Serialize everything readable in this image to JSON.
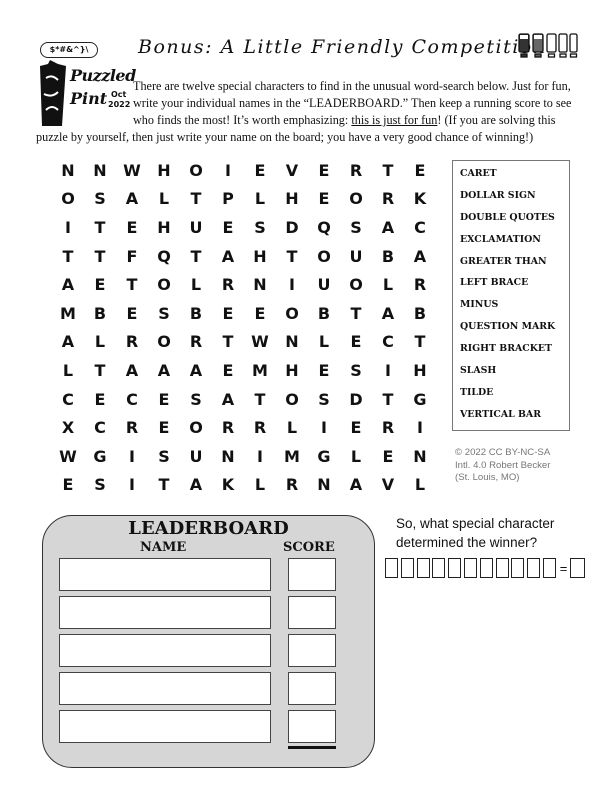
{
  "header": {
    "title": "Bonus: A Little Friendly Competition"
  },
  "logo": {
    "symbols": "$*#&^}\\",
    "line1": "Puzzled",
    "line2": "Pint",
    "date1": "Oct",
    "date2": "2022"
  },
  "intro": {
    "part1": "There are twelve special characters to find in the unusual word-search below. Just for fun, write your individual names in the “LEADERBOARD.” Then keep a running score to see who finds the most! It’s worth emphasizing: ",
    "emphasis": "this is just for fun",
    "part2": "! (If you are solving this puzzle by yourself, then just write your name on the board; you have a very good chance of winning!)"
  },
  "grid": [
    "NNWHOIEVERTE",
    "OSALTPLHEORK",
    "ITEHUESDQSAC",
    "TTFQTAHTOUBA",
    "AETOLRNIUOLR",
    "MBESBEEOBTAB",
    "ALRORTWNLECT",
    "LTAAAEMHESIH",
    "CECESATOSDTG",
    "XCREORRLIERI",
    "WGISUNIMGLEN",
    "ESITAKLRNAVL"
  ],
  "words": [
    "CARET",
    "DOLLAR SIGN",
    "DOUBLE QUOTES",
    "EXCLAMATION",
    "GREATER THAN",
    "LEFT BRACE",
    "MINUS",
    "QUESTION MARK",
    "RIGHT BRACKET",
    "SLASH",
    "TILDE",
    "VERTICAL BAR"
  ],
  "copyright": {
    "line1": "© 2022 CC BY-NC-SA",
    "line2": "Intl. 4.0  Robert Becker",
    "line3": "(St. Louis, MO)"
  },
  "leaderboard": {
    "title": "LEADERBOARD",
    "name_header": "NAME",
    "score_header": "SCORE",
    "rows": 5
  },
  "question": {
    "line1": "So, what special character",
    "line2": "determined the winner?"
  },
  "answer": {
    "boxes": 11,
    "equals": "="
  }
}
